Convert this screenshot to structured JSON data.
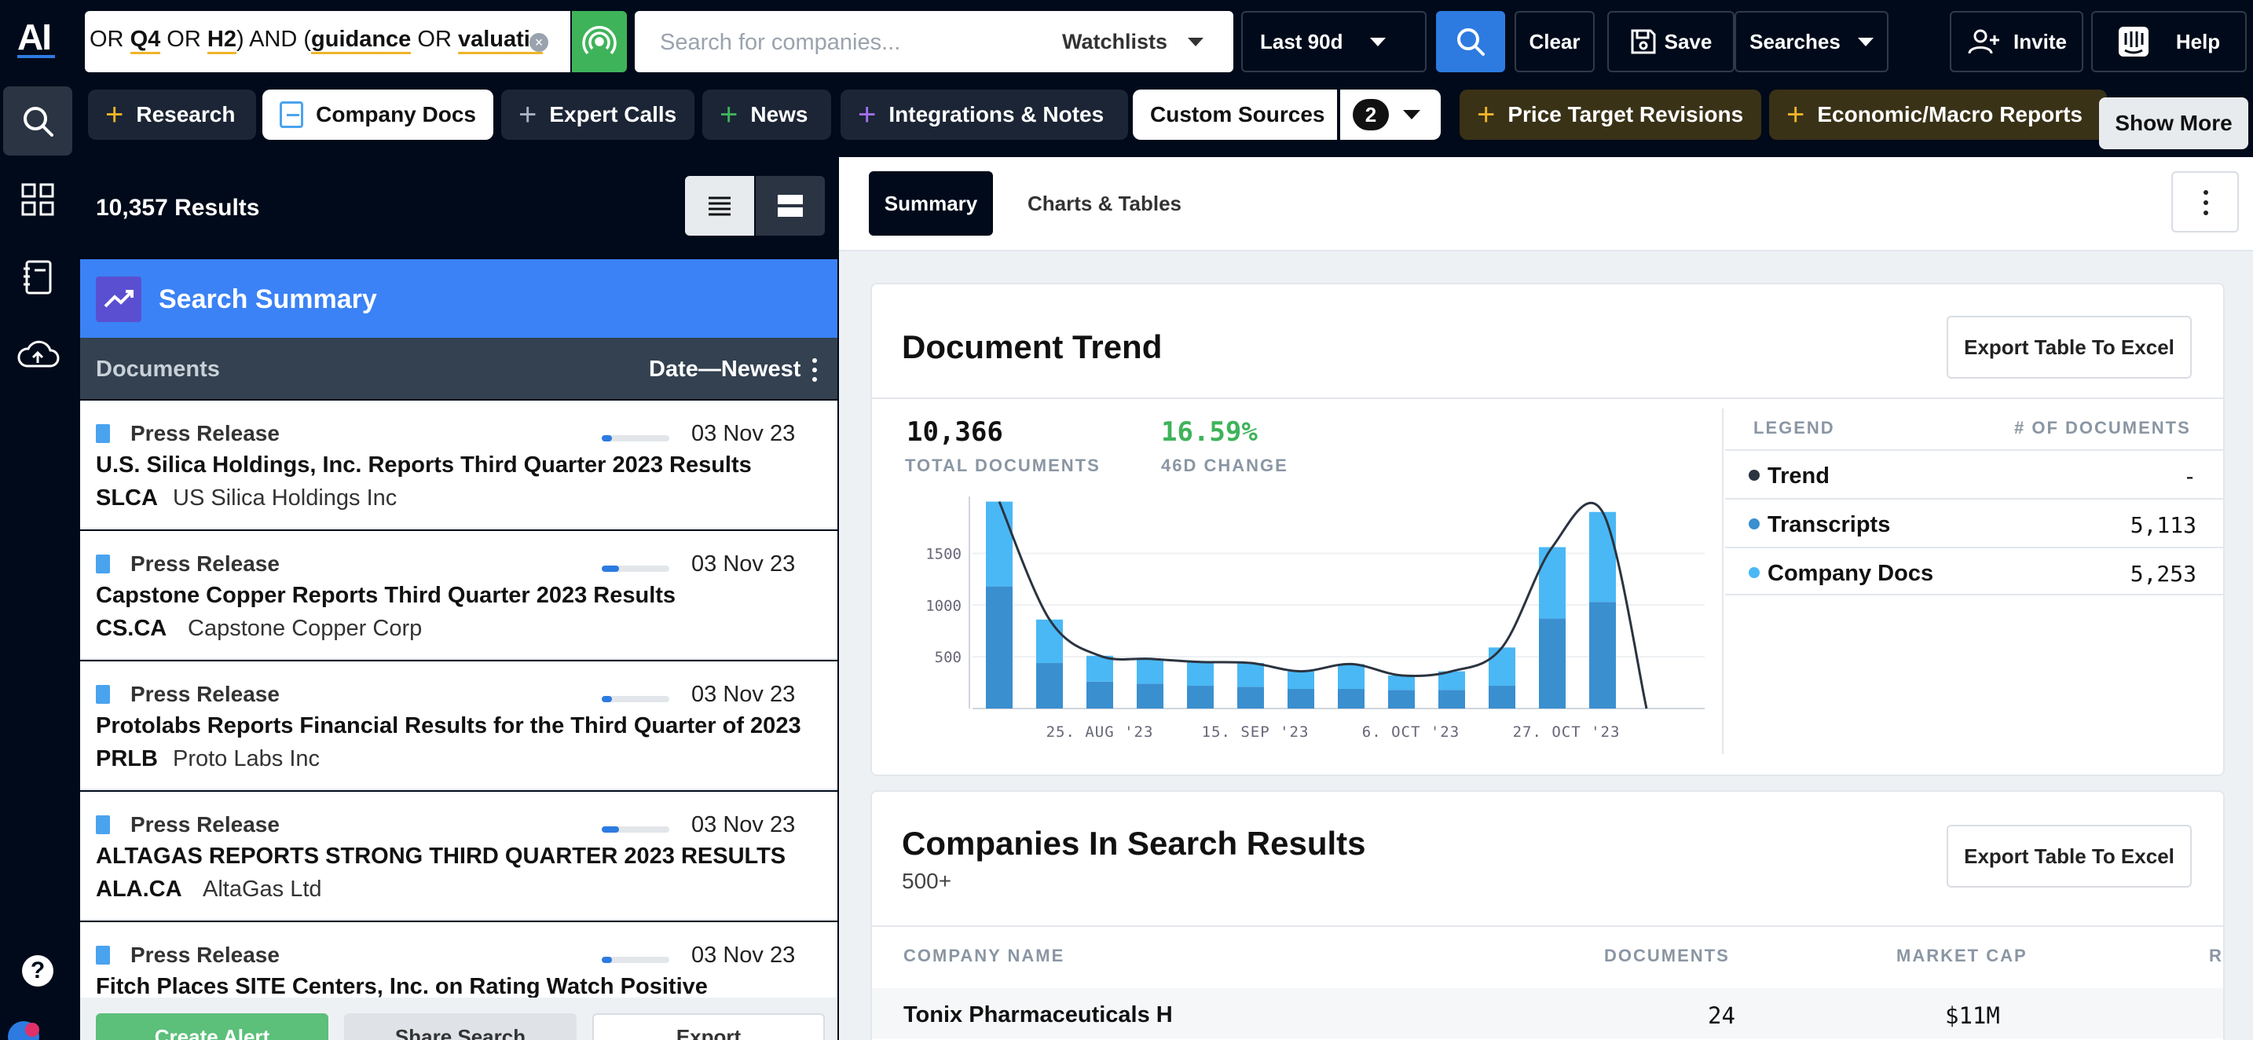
{
  "header": {
    "logo": "AI",
    "query_terms": [
      {
        "text": "OR ",
        "mark": false
      },
      {
        "text": "Q4",
        "mark": true
      },
      {
        "text": " OR ",
        "mark": false
      },
      {
        "text": "H2",
        "mark": true
      },
      {
        "text": ") AND (",
        "mark": false
      },
      {
        "text": "guidance",
        "mark": true
      },
      {
        "text": " OR ",
        "mark": false
      },
      {
        "text": "valuatic",
        "mark": true
      }
    ],
    "search_placeholder": "Search for companies...",
    "watchlists_label": "Watchlists",
    "date_range_label": "Last 90d",
    "clear_label": "Clear",
    "save_label": "Save",
    "searches_label": "Searches",
    "invite_label": "Invite",
    "help_label": "Help"
  },
  "filters": {
    "items": [
      {
        "label": "Research",
        "plus_color": "#f0b429"
      },
      {
        "label": "Company Docs",
        "plus_color": "#4aa3ef"
      },
      {
        "label": "Expert Calls",
        "plus_color": "#aab3bf"
      },
      {
        "label": "News",
        "plus_color": "#3fb35a"
      },
      {
        "label": "Integrations & Notes",
        "plus_color": "#a46ef0"
      }
    ],
    "custom_sources_label": "Custom Sources",
    "custom_sources_count": "2",
    "gold_items": [
      "Price Target Revisions",
      "Economic/Macro Reports"
    ],
    "show_more_label": "Show More"
  },
  "results": {
    "count_label": "10,357 Results",
    "summary_label": "Search Summary",
    "documents_label": "Documents",
    "sort_label": "Date—Newest",
    "docs": [
      {
        "type": "Press Release",
        "date": "03 Nov 23",
        "title": "U.S. Silica Holdings, Inc. Reports Third Quarter 2023 Results",
        "ticker": "SLCA",
        "company": "US Silica Holdings Inc",
        "relevance": 0.15
      },
      {
        "type": "Press Release",
        "date": "03 Nov 23",
        "title": "Capstone Copper Reports Third Quarter 2023 Results",
        "ticker": "CS.CA",
        "company": "Capstone Copper Corp",
        "relevance": 0.25
      },
      {
        "type": "Press Release",
        "date": "03 Nov 23",
        "title": "Protolabs Reports Financial Results for the Third Quarter of 2023",
        "ticker": "PRLB",
        "company": "Proto Labs Inc",
        "relevance": 0.15
      },
      {
        "type": "Press Release",
        "date": "03 Nov 23",
        "title": "ALTAGAS REPORTS STRONG THIRD QUARTER 2023 RESULTS",
        "ticker": "ALA.CA",
        "company": "AltaGas Ltd",
        "relevance": 0.25
      },
      {
        "type": "Press Release",
        "date": "03 Nov 23",
        "title": "Fitch Places SITE Centers, Inc. on Rating Watch Positive",
        "ticker": "",
        "company": "",
        "relevance": 0.15
      }
    ],
    "bottom_buttons": [
      "Create Alert",
      "Share Search",
      "Export"
    ]
  },
  "main": {
    "tabs": [
      "Summary",
      "Charts & Tables"
    ],
    "trend": {
      "title": "Document Trend",
      "export_label": "Export Table To Excel",
      "total_value": "10,366",
      "total_label": "TOTAL DOCUMENTS",
      "change_value": "16.59%",
      "change_label": "46D CHANGE",
      "legend_header": "LEGEND",
      "count_header": "# OF DOCUMENTS",
      "legend": [
        {
          "name": "Trend",
          "count": "-",
          "color": "#2b3440"
        },
        {
          "name": "Transcripts",
          "count": "5,113",
          "color": "#3a8fcf"
        },
        {
          "name": "Company Docs",
          "count": "5,253",
          "color": "#4ab8f5"
        }
      ]
    },
    "companies": {
      "title": "Companies In Search Results",
      "subtitle": "500+",
      "export_label": "Export Table To Excel",
      "columns": [
        "COMPANY NAME",
        "DOCUMENTS",
        "MARKET CAP",
        "R"
      ],
      "rows": [
        {
          "name": "Tonix Pharmaceuticals H",
          "documents": "24",
          "market_cap": "$11M"
        }
      ]
    }
  },
  "chart_data": {
    "type": "bar",
    "categories": [
      "25. AUG '23",
      "15. SEP '23",
      "6. OCT '23",
      "27. OCT '23"
    ],
    "x_tick_labels": [
      "25. AUG '23",
      "15. SEP '23",
      "6. OCT '23",
      "27. OCT '23"
    ],
    "y_ticks": [
      500,
      1000,
      1500
    ],
    "ylim": [
      0,
      2050
    ],
    "series": [
      {
        "name": "Transcripts",
        "values": [
          1180,
          440,
          260,
          240,
          220,
          210,
          190,
          190,
          180,
          180,
          220,
          870,
          1030
        ],
        "color": "#3a8fcf"
      },
      {
        "name": "Company Docs",
        "values": [
          820,
          420,
          250,
          240,
          230,
          230,
          170,
          240,
          140,
          180,
          370,
          690,
          870
        ],
        "color": "#4ab8f5"
      },
      {
        "name": "Trend",
        "type": "line",
        "color": "#2b3440"
      }
    ]
  }
}
